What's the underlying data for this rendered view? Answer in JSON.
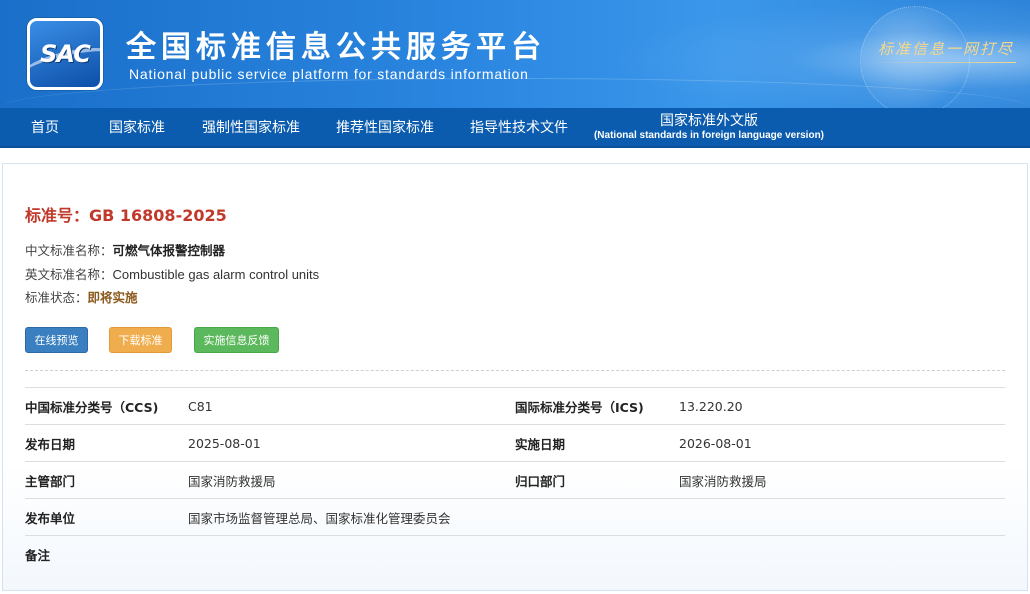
{
  "header": {
    "logo_text": "SAC",
    "title": "全国标准信息公共服务平台",
    "subtitle": "National public service platform  for standards information",
    "slogan": "标准信息一网打尽"
  },
  "nav": {
    "items": [
      {
        "label": "首页"
      },
      {
        "label": "国家标准"
      },
      {
        "label": "强制性国家标准"
      },
      {
        "label": "推荐性国家标准"
      },
      {
        "label": "指导性技术文件"
      },
      {
        "label": "国家标准外文版",
        "sub": "(National standards in foreign language version)"
      }
    ]
  },
  "standard": {
    "number_label": "标准号：GB 16808-2025",
    "cn_name_label": "中文标准名称：",
    "cn_name": "可燃气体报警控制器",
    "en_name_label": "英文标准名称：",
    "en_name": "Combustible gas alarm control units",
    "status_label": "标准状态：",
    "status": "即将实施"
  },
  "buttons": {
    "preview": "在线预览",
    "download": "下载标准",
    "feedback": "实施信息反馈"
  },
  "details": [
    {
      "k1": "中国标准分类号（CCS)",
      "v1": "C81",
      "k2": "国际标准分类号（ICS)",
      "v2": "13.220.20"
    },
    {
      "k1": "发布日期",
      "v1": "2025-08-01",
      "k2": "实施日期",
      "v2": "2026-08-01"
    },
    {
      "k1": "主管部门",
      "v1": "国家消防救援局",
      "k2": "归口部门",
      "v2": "国家消防救援局"
    },
    {
      "k1": "发布单位",
      "v1": "国家市场监督管理总局、国家标准化管理委员会",
      "k2": "",
      "v2": ""
    },
    {
      "k1": "备注",
      "v1": "",
      "k2": "",
      "v2": ""
    }
  ],
  "colors": {
    "nav_bg": "#0b5cae",
    "standard_number": "#c0392b",
    "status": "#8b5a1e",
    "btn_preview": "#3a7fbf",
    "btn_download": "#f0ad4e",
    "btn_feedback": "#5cb85c"
  }
}
